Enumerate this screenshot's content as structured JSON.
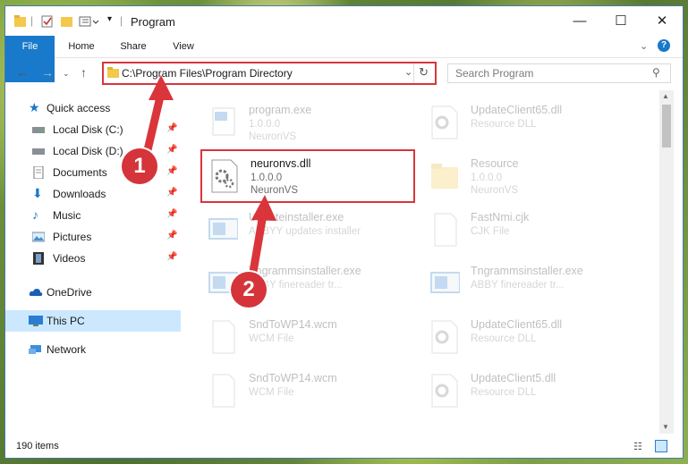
{
  "window": {
    "title": "Program",
    "controls": {
      "minimize": "—",
      "maximize": "☐",
      "close": "✕"
    }
  },
  "ribbon": {
    "tabs": [
      "File",
      "Home",
      "Share",
      "View"
    ]
  },
  "address_bar": {
    "path": "C:\\Program Files\\Program Directory",
    "search_placeholder": "Search Program"
  },
  "sidebar": {
    "items": [
      {
        "label": "Quick access"
      },
      {
        "label": "Local Disk (C:)"
      },
      {
        "label": "Local Disk (D:)"
      },
      {
        "label": "Documents"
      },
      {
        "label": "Downloads"
      },
      {
        "label": "Music"
      },
      {
        "label": "Pictures"
      },
      {
        "label": "Videos"
      },
      {
        "label": "OneDrive"
      },
      {
        "label": "This PC"
      },
      {
        "label": "Network"
      }
    ]
  },
  "files": {
    "left": [
      {
        "name": "program.exe",
        "line2": "1.0.0.0",
        "line3": "NeuronVS"
      },
      {
        "name": "neuronvs.dll",
        "line2": "1.0.0.0",
        "line3": "NeuronVS"
      },
      {
        "name": "Updateinstaller.exe",
        "line2": "ABBYY updates installer",
        "line3": ""
      },
      {
        "name": "Tngrammsinstaller.exe",
        "line2": "ABBY finereader tr...",
        "line3": ""
      },
      {
        "name": "SndToWP14.wcm",
        "line2": "WCM File",
        "line3": ""
      },
      {
        "name": "SndToWP14.wcm",
        "line2": "WCM File",
        "line3": ""
      }
    ],
    "right": [
      {
        "name": "UpdateClient65.dll",
        "line2": "Resource DLL",
        "line3": ""
      },
      {
        "name": "Resource",
        "line2": "1.0.0.0",
        "line3": "NeuronVS"
      },
      {
        "name": "FastNmi.cjk",
        "line2": "CJK File",
        "line3": ""
      },
      {
        "name": "Tngrammsinstaller.exe",
        "line2": "ABBY finereader tr...",
        "line3": ""
      },
      {
        "name": "UpdateClient65.dll",
        "line2": "Resource DLL",
        "line3": ""
      },
      {
        "name": "UpdateClient5.dll",
        "line2": "Resource DLL",
        "line3": ""
      }
    ]
  },
  "status": {
    "item_count": "190 items"
  },
  "annotations": {
    "step1": "1",
    "step2": "2"
  },
  "colors": {
    "accent": "#1979ca",
    "highlight": "#d9353b",
    "selected": "#cce8ff"
  }
}
